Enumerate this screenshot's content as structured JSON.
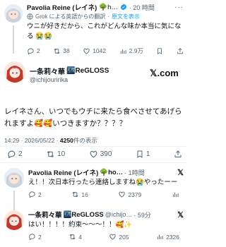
{
  "tweet1": {
    "name": "Pavolia Reine (レイネ)",
    "name_trail": "🌳h…",
    "time": "· 20 時間",
    "translation_note": "Grok による英語からの翻訳",
    "original_link": "原文を表示",
    "text": "ウニが好きだから、これがどんな味か本当に気になる 😭😭",
    "replies": "2",
    "retweets": "38",
    "likes": "1042",
    "views": "2.9万"
  },
  "tweet2": {
    "name": "一条莉々華",
    "name_trail": "🌃ReGLOSS",
    "handle": "@ichijouririka",
    "platform": "𝕏.com",
    "text": "レイネさん、いつでもウチに来たら食べさせてあげられますよ🥰🥰いつきますか？？？？",
    "timestamp": "14:29 · 2026/05/22 · ",
    "views_count": "4250",
    "views_label": "件の表示",
    "replies": "2",
    "retweets": "10",
    "likes": "390",
    "bookmarks": "1"
  },
  "tweet3": {
    "name": "Pavolia Reine (レイネ)",
    "name_trail": "🌳ho…",
    "time": "· 1時間",
    "text": "え！！次日本行ったら連絡しますね😭やったーー",
    "replies": "2",
    "retweets": "16",
    "likes": "2379"
  },
  "tweet4": {
    "name": "一条莉々華",
    "name_trail": "🌃ReGLOSS",
    "handle": "@ichijo…",
    "time": "· 59分",
    "text": "はい！！！！約束〜〜〜！！🥰✨",
    "replies": "2",
    "retweets": "4",
    "likes": "205",
    "views": "2326"
  },
  "colors": {
    "verified": "#1d9bf0",
    "text": "#0f1419",
    "secondary": "#536471",
    "link": "#1d9bf0"
  }
}
